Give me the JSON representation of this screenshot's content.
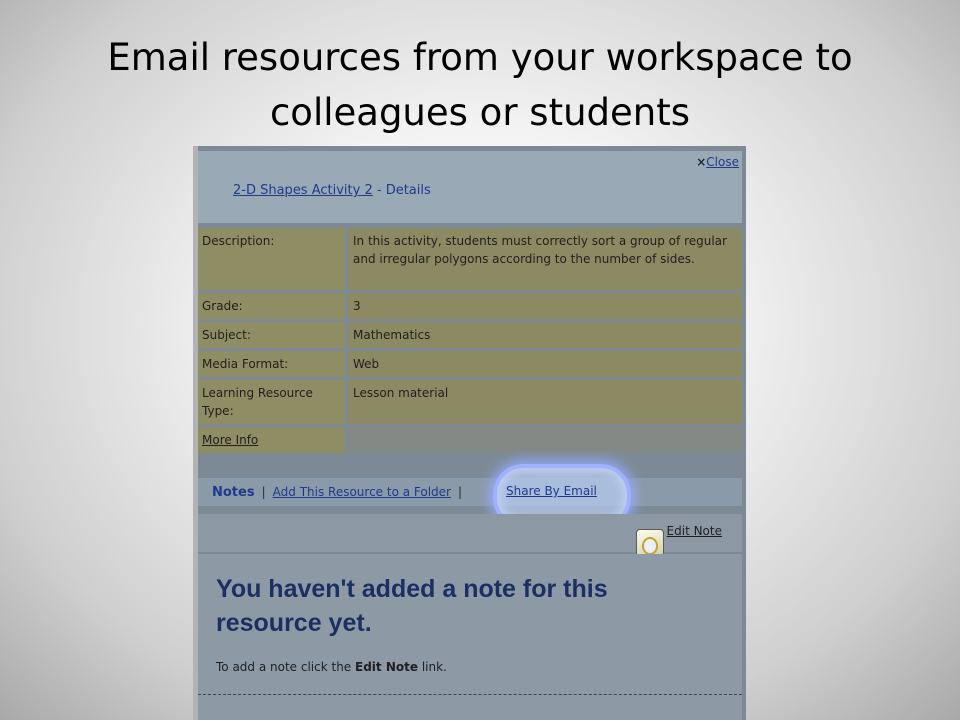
{
  "slide": {
    "title_line1": "Email resources from your workspace to",
    "title_line2": "colleagues or students"
  },
  "dialog": {
    "close_label": "Close",
    "close_glyph": "×",
    "resource_title": "2-D Shapes Activity 2",
    "header_suffix": " - Details",
    "fields": [
      {
        "label": "Description:",
        "value": "In this activity, students must correctly sort a group of regular and irregular polygons according to the number of sides."
      },
      {
        "label": "Grade:",
        "value": "3"
      },
      {
        "label": "Subject:",
        "value": "Mathematics"
      },
      {
        "label": "Media Format:",
        "value": "Web"
      },
      {
        "label": "Learning Resource Type:",
        "value": "Lesson material"
      }
    ],
    "more_info_label": "More Info",
    "notes_tab_label": "Notes",
    "separator": "|",
    "add_to_folder_label": "Add This Resource to a Folder",
    "share_email_label": "Share By Email",
    "edit_note_label": "Edit Note",
    "empty_note_heading": "You haven't added a note for this resource yet.",
    "hint_prefix": "To add a note click the ",
    "hint_bold": "Edit Note",
    "hint_suffix": " link."
  },
  "icons": {
    "note_icon": "edit-note-icon"
  }
}
